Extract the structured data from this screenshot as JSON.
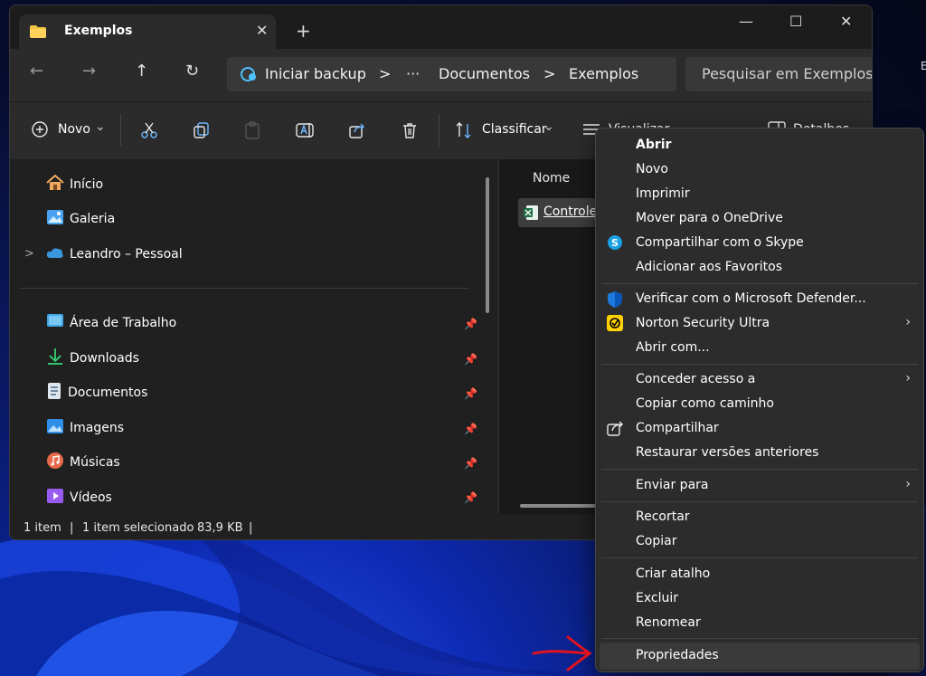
{
  "window": {
    "tab_title": "Exemplos",
    "tab_close": "✕",
    "new_tab": "+",
    "minimize": "—",
    "maximize": "☐",
    "close": "✕"
  },
  "addressbar": {
    "back": "←",
    "forward": "→",
    "up": "↑",
    "refresh": "↻",
    "backup_label": "Iniciar backup",
    "sep1": ">",
    "ellipsis": "···",
    "crumb1": "Documentos",
    "sep2": ">",
    "crumb2": "Exemplos",
    "search_placeholder": "Pesquisar em Exemplos"
  },
  "toolbar": {
    "new_label": "Novo",
    "new_chevron": "⌄",
    "sort_label": "Classificar",
    "sort_chevron": "⌄",
    "view_label": "Visualizar",
    "details_label": "Detalhes"
  },
  "sidebar": {
    "items": [
      {
        "label": "Início",
        "icon": "home-icon"
      },
      {
        "label": "Galeria",
        "icon": "gallery-icon"
      },
      {
        "label": "Leandro – Pessoal",
        "icon": "onedrive-cloud-icon",
        "expand": ">"
      }
    ],
    "pinned": [
      {
        "label": "Área de Trabalho",
        "icon": "desktop-icon"
      },
      {
        "label": "Downloads",
        "icon": "download-icon"
      },
      {
        "label": "Documentos",
        "icon": "documents-icon"
      },
      {
        "label": "Imagens",
        "icon": "pictures-icon"
      },
      {
        "label": "Músicas",
        "icon": "music-icon"
      },
      {
        "label": "Vídeos",
        "icon": "videos-icon"
      }
    ]
  },
  "content": {
    "column_name": "Nome",
    "file_name": "Controle-"
  },
  "status": {
    "count": "1 item",
    "div1": "|",
    "selected": "1 item selecionado",
    "size": "83,9 KB",
    "div2": "|"
  },
  "context_menu": {
    "items": [
      {
        "label": "Abrir",
        "bold": true
      },
      {
        "label": "Novo"
      },
      {
        "label": "Imprimir"
      },
      {
        "label": "Mover para o OneDrive"
      },
      {
        "label": "Compartilhar com o Skype",
        "icon": "skype-icon"
      },
      {
        "label": "Adicionar aos Favoritos"
      },
      {
        "label": "Verificar com o Microsoft Defender...",
        "icon": "defender-shield-icon"
      },
      {
        "label": "Norton Security Ultra",
        "icon": "norton-icon",
        "submenu": true
      },
      {
        "label": "Abrir com..."
      },
      {
        "label": "Conceder acesso a",
        "submenu": true
      },
      {
        "label": "Copiar como caminho"
      },
      {
        "label": "Compartilhar",
        "icon": "share-icon"
      },
      {
        "label": "Restaurar versões anteriores"
      },
      {
        "label": "Enviar para",
        "submenu": true
      },
      {
        "label": "Recortar"
      },
      {
        "label": "Copiar"
      },
      {
        "label": "Criar atalho"
      },
      {
        "label": "Excluir"
      },
      {
        "label": "Renomear"
      },
      {
        "label": "Propriedades",
        "highlighted": true
      }
    ],
    "chevron": "›"
  },
  "colors": {
    "accent": "#0067c0",
    "excel_green": "#1d6f42",
    "annotation_red": "#e0141e"
  },
  "desktop_edge_text": "E"
}
